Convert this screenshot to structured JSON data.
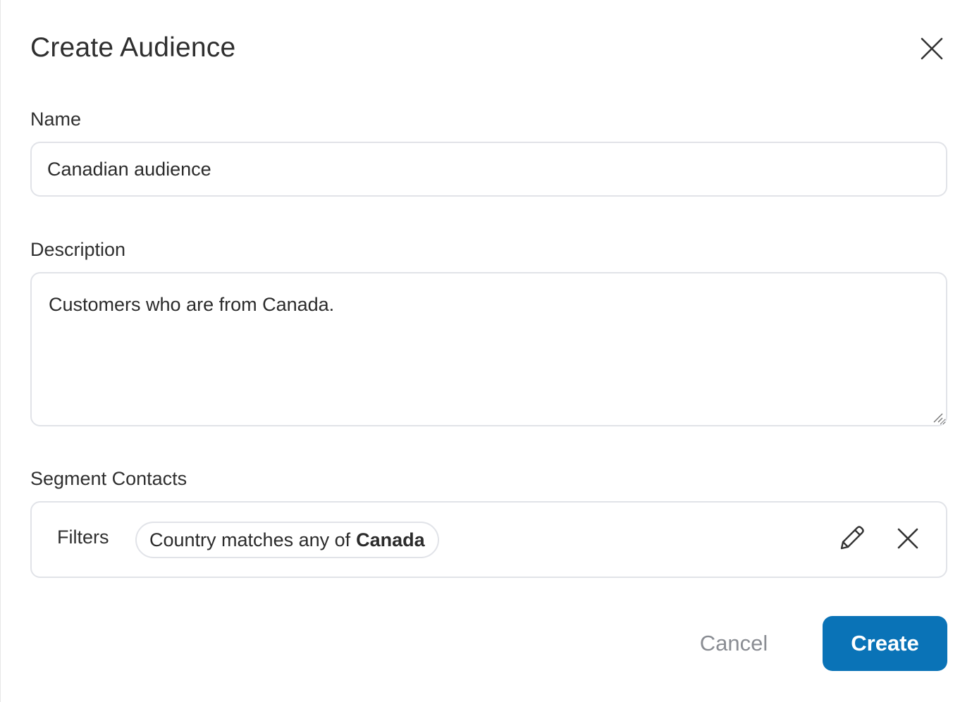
{
  "dialog": {
    "title": "Create Audience"
  },
  "icons": {
    "close": "close-icon",
    "edit": "pencil-icon",
    "remove": "close-icon"
  },
  "form": {
    "name_label": "Name",
    "name_value": "Canadian audience",
    "description_label": "Description",
    "description_value": "Customers who are from Canada.",
    "segment_label": "Segment Contacts"
  },
  "segment": {
    "filters_label": "Filters",
    "filter_chip": {
      "prefix": "Country matches any of",
      "value": "Canada"
    }
  },
  "actions": {
    "cancel_label": "Cancel",
    "create_label": "Create"
  },
  "colors": {
    "primary": "#0a73b7",
    "border": "#e1e3e8",
    "muted_text": "#8a8d93"
  }
}
